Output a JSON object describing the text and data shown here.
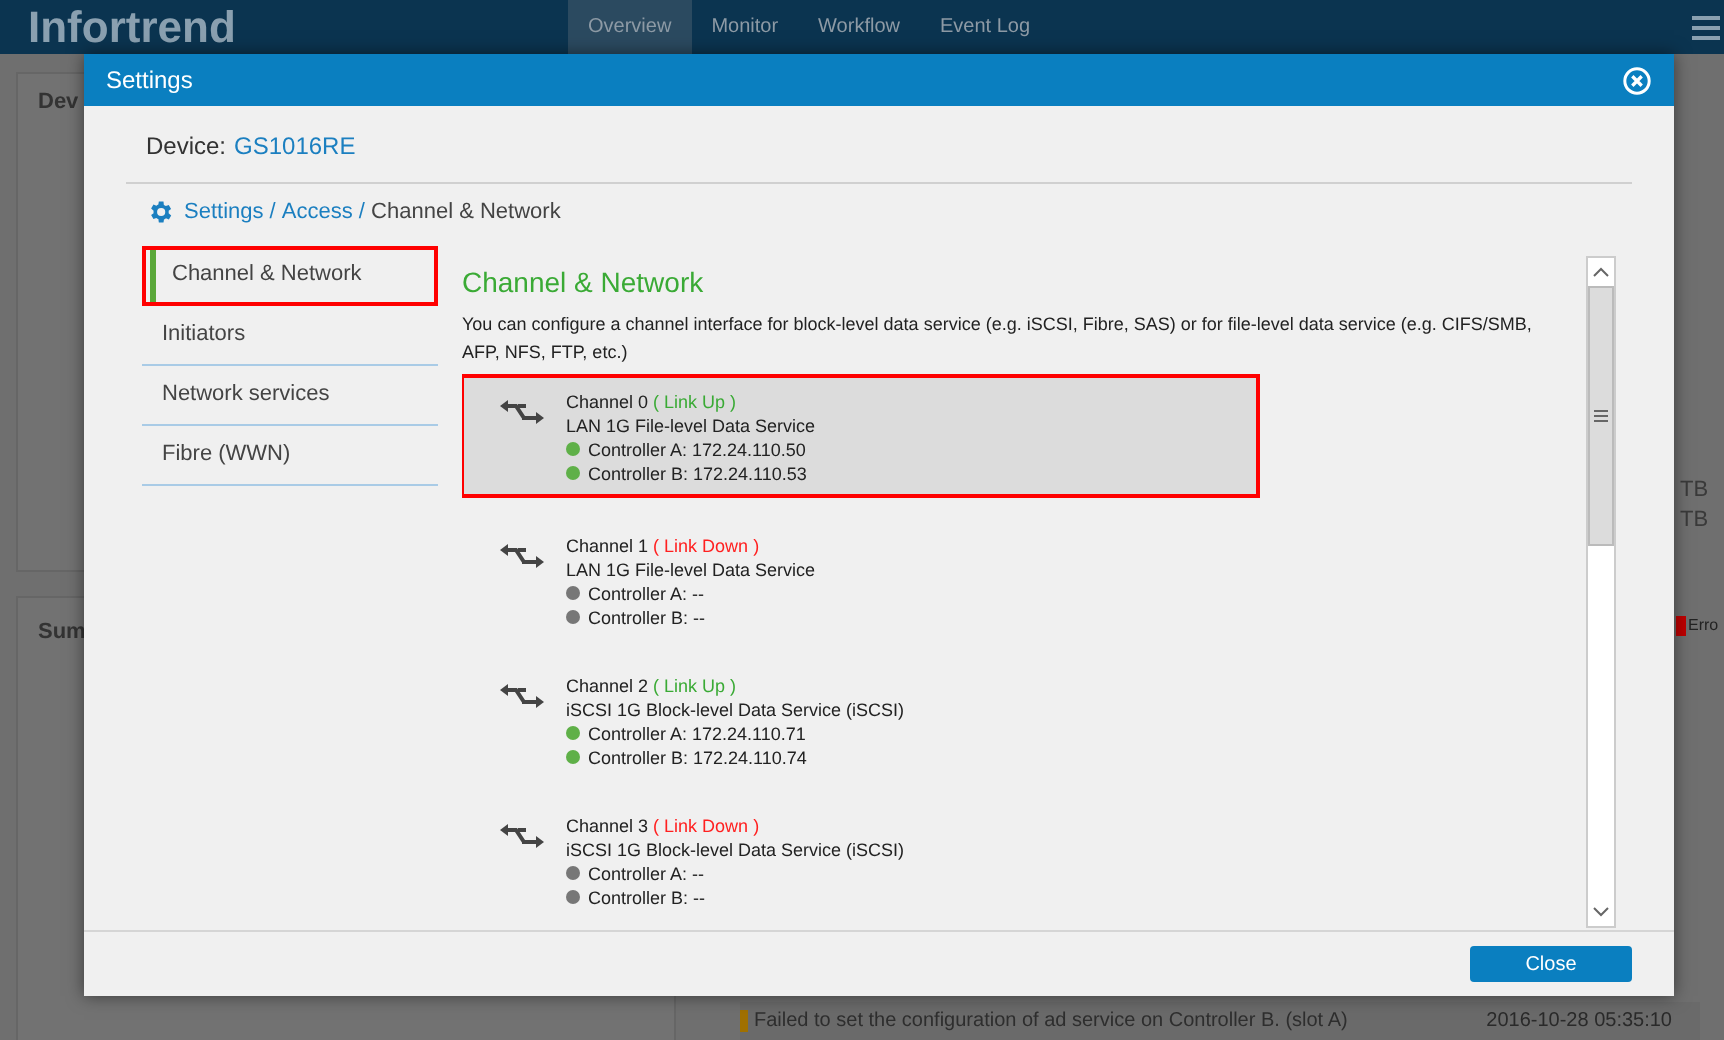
{
  "app": {
    "logo": "Infortrend",
    "nav": [
      {
        "label": "Overview",
        "selected": true
      },
      {
        "label": "Monitor",
        "selected": false
      },
      {
        "label": "Workflow",
        "selected": false
      },
      {
        "label": "Event Log",
        "selected": false
      }
    ],
    "device_panel_title": "Dev",
    "summary_title": "Sum",
    "capacity": [
      "TB",
      "TB"
    ],
    "legend": {
      "label": "Erro",
      "color": "#c00000"
    },
    "event": {
      "text": "Failed to set the configuration of ad service on Controller B. (slot A)",
      "time": "2016-10-28 05:35:10"
    }
  },
  "dialog": {
    "title": "Settings",
    "device_label": "Device:",
    "device_name": "GS1016RE",
    "breadcrumb": [
      {
        "label": "Settings / ",
        "link": true
      },
      {
        "label": "Access / ",
        "link": true
      },
      {
        "label": "Channel & Network",
        "link": false
      }
    ],
    "sidebar": [
      {
        "label": "Channel & Network",
        "selected": true
      },
      {
        "label": "Initiators",
        "selected": false
      },
      {
        "label": "Network services",
        "selected": false
      },
      {
        "label": "Fibre (WWN)",
        "selected": false
      }
    ],
    "heading": "Channel & Network",
    "description": "You can configure a channel interface for block-level data service (e.g. iSCSI, Fibre, SAS) or for file-level data service (e.g. CIFS/SMB, AFP, NFS, FTP, etc.)",
    "channels": [
      {
        "name": "Channel 0",
        "status": "( Link Up )",
        "up": true,
        "selected": true,
        "service": "LAN 1G File-level Data Service",
        "controllers": [
          {
            "text": "Controller A: 172.24.110.50",
            "online": true
          },
          {
            "text": "Controller B: 172.24.110.53",
            "online": true
          }
        ]
      },
      {
        "name": "Channel 1",
        "status": "( Link Down )",
        "up": false,
        "selected": false,
        "service": "LAN 1G File-level Data Service",
        "controllers": [
          {
            "text": "Controller A: --",
            "online": false
          },
          {
            "text": "Controller B: --",
            "online": false
          }
        ]
      },
      {
        "name": "Channel 2",
        "status": "( Link Up )",
        "up": true,
        "selected": false,
        "service": "iSCSI 1G Block-level Data Service (iSCSI)",
        "controllers": [
          {
            "text": "Controller A: 172.24.110.71",
            "online": true
          },
          {
            "text": "Controller B: 172.24.110.74",
            "online": true
          }
        ]
      },
      {
        "name": "Channel 3",
        "status": "( Link Down )",
        "up": false,
        "selected": false,
        "service": "iSCSI 1G Block-level Data Service (iSCSI)",
        "controllers": [
          {
            "text": "Controller A: --",
            "online": false
          },
          {
            "text": "Controller B: --",
            "online": false
          }
        ]
      }
    ],
    "close_button": "Close"
  }
}
